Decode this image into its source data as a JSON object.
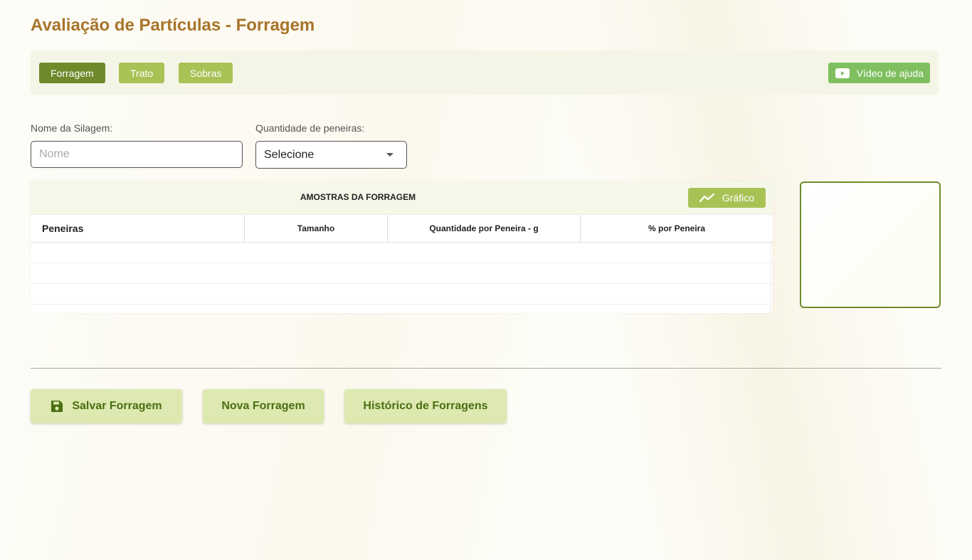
{
  "page": {
    "title": "Avaliação de Partículas - Forragem"
  },
  "tabs": [
    {
      "label": "Forragem",
      "active": true
    },
    {
      "label": "Trato",
      "active": false
    },
    {
      "label": "Sobras",
      "active": false
    }
  ],
  "help": {
    "label": "Vídeo de ajuda",
    "icon": "youtube-icon"
  },
  "form": {
    "name_label": "Nome da Silagem:",
    "name_placeholder": "Nome",
    "name_value": "",
    "sieves_label": "Quantidade de peneiras:",
    "sieves_value": "Selecione"
  },
  "table": {
    "title": "AMOSTRAS DA FORRAGEM",
    "chart_button": "Gráfico",
    "columns": [
      "Peneiras",
      "Tamanho",
      "Quantidade por Peneira - g",
      "% por  Peneira"
    ]
  },
  "actions": {
    "save": "Salvar Forragem",
    "new": "Nova Forragem",
    "history": "Histórico de Forragens"
  },
  "colors": {
    "title": "#a8742a",
    "accent_dark": "#6e8a2b",
    "accent_light": "#a9c256",
    "help_button": "#7fbf5f",
    "action_bg": "#dde9b0"
  }
}
